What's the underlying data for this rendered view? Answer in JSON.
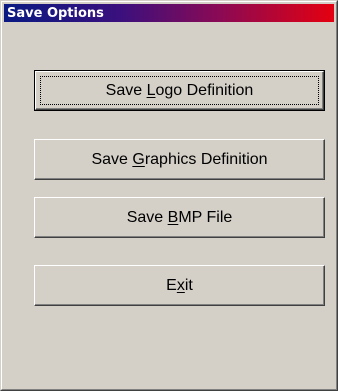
{
  "window": {
    "title": "Save Options"
  },
  "buttons": [
    {
      "pre": "Save ",
      "key": "L",
      "post": "ogo Definition",
      "is_default": true
    },
    {
      "pre": "Save ",
      "key": "G",
      "post": "raphics Definition",
      "is_default": false
    },
    {
      "pre": "Save ",
      "key": "B",
      "post": "MP File",
      "is_default": false
    },
    {
      "pre": "E",
      "key": "x",
      "post": "it",
      "is_default": false
    }
  ],
  "colors": {
    "face": "#d4d0c8",
    "title_gradient_start": "#0a1a82",
    "title_gradient_end": "#e40010",
    "title_text": "#ffffff"
  }
}
